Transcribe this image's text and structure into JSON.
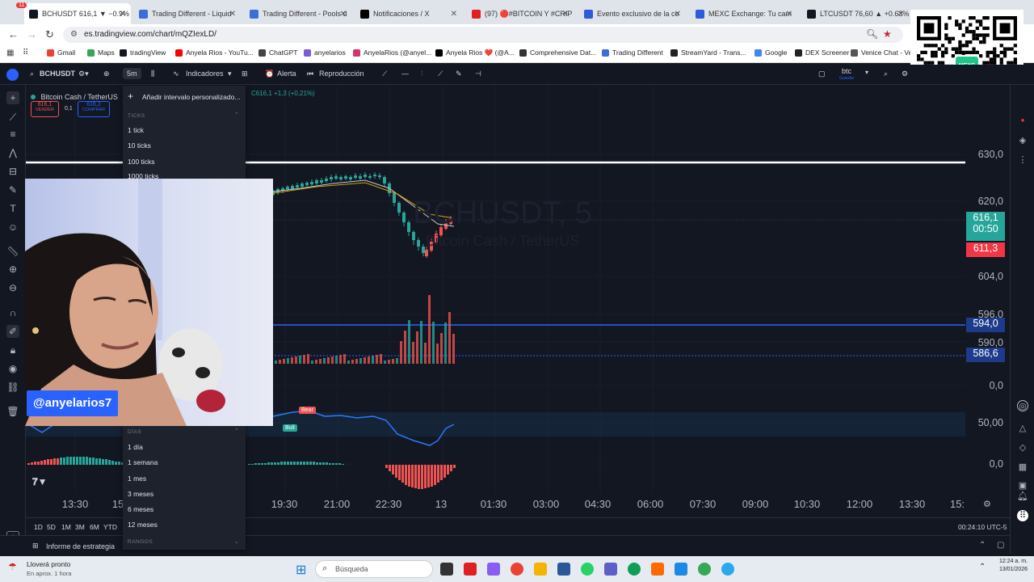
{
  "browser": {
    "tabs": [
      {
        "label": "BCHUSDT 616,1 ▼ −0.9%",
        "color": "#131722",
        "active": true
      },
      {
        "label": "Trading Different - Liquid",
        "color": "#3b6fd6"
      },
      {
        "label": "Trading Different - Pools d",
        "color": "#3b6fd6"
      },
      {
        "label": "Notificaciones / X",
        "color": "#000000"
      },
      {
        "label": "(97) 🔴#BITCOIN Y #CRIP",
        "color": "#e02020"
      },
      {
        "label": "Evento exclusivo de la co",
        "color": "#2e5bd8"
      },
      {
        "label": "MEXC Exchange: Tu cam",
        "color": "#2e5bd8"
      },
      {
        "label": "LTCUSDT 76,60 ▲ +0.63%",
        "color": "#131722"
      }
    ],
    "tab_badge": "11",
    "url": "es.tradingview.com/chart/mQZIexLD/",
    "bookmarks": [
      {
        "label": "Gmail",
        "color": "#ea4335"
      },
      {
        "label": "Maps",
        "color": "#34a853"
      },
      {
        "label": "tradingView",
        "color": "#131722"
      },
      {
        "label": "Anyela Rios - YouTu...",
        "color": "#ff0000"
      },
      {
        "label": "ChatGPT",
        "color": "#444444"
      },
      {
        "label": "anyelarios",
        "color": "#7b5cd6"
      },
      {
        "label": "AnyelaRios (@anyel...",
        "color": "#d6336c"
      },
      {
        "label": "Anyela Rios ❤️ (@A...",
        "color": "#000000"
      },
      {
        "label": "Comprehensive Dat...",
        "color": "#333333"
      },
      {
        "label": "Trading Different",
        "color": "#3b6fd6"
      },
      {
        "label": "StreamYard - Trans...",
        "color": "#222222"
      },
      {
        "label": "Google",
        "color": "#4285f4"
      },
      {
        "label": "DEX Screener",
        "color": "#222222"
      },
      {
        "label": "Venice Chat - Ve",
        "color": "#555555"
      }
    ]
  },
  "toolbar": {
    "symbol": "BCHUSDT",
    "interval": "5m",
    "indicators": "Indicadores",
    "alert": "Alerta",
    "replay": "Reproducción",
    "search_text": "btc",
    "search_sub": "Guardar"
  },
  "legend": {
    "name": "Bitcoin Cash / TetherUS",
    "sell_price": "616,1",
    "sell_label": "VENDER",
    "spread": "0,1",
    "buy_price": "616,2",
    "buy_label": "COMPRAR",
    "change": "C616,1 +1,3 (+0,21%)"
  },
  "watermark": {
    "symbol": "BCHUSDT, 5",
    "name": "Bitcoin Cash / TetherUS"
  },
  "dropdown": {
    "add_custom": "Añadir intervalo personalizado...",
    "ticks_header": "TICKS",
    "ticks": [
      "1 tick",
      "10 ticks",
      "100 ticks",
      "1000 ticks"
    ],
    "days_header": "DÍAS",
    "days": [
      "1 día",
      "1 semana",
      "1 mes",
      "3 meses",
      "6 meses",
      "12 meses"
    ],
    "ranges_header": "RANGOS"
  },
  "price_axis": {
    "labels": [
      "630,0",
      "620,0",
      "604,0",
      "596,0",
      "590,0",
      "0,0",
      "50,00",
      "0,0"
    ],
    "current_price": "616,1",
    "countdown": "00:50",
    "bid_tag": "611,3",
    "level_tag_1": "594,0",
    "level_tag_2": "586,6"
  },
  "indicator_labels": {
    "bear": "Bear",
    "bull": "Bull"
  },
  "time_axis": [
    "13:30",
    "15",
    "19:30",
    "21:00",
    "22:30",
    "13",
    "01:30",
    "03:00",
    "04:30",
    "06:00",
    "07:30",
    "09:00",
    "10:30",
    "12:00",
    "13:30",
    "15:"
  ],
  "range_bar": {
    "buttons": [
      "1D",
      "5D",
      "1M",
      "3M",
      "6M",
      "YTD"
    ],
    "clock": "00:24:10 UTC-5"
  },
  "bottom": {
    "strategy_report": "Informe de estrategia"
  },
  "webcam": {
    "handle": "@anyelarios7"
  },
  "qr": {
    "label": "MEXC"
  },
  "taskbar": {
    "weather_title": "Lloverá pronto",
    "weather_sub": "En aprox. 1 hora",
    "search_placeholder": "Búsqueda",
    "time": "12:24 a. m.",
    "date": "13/01/2026"
  },
  "colors": {
    "up": "#26a69a",
    "down": "#ef5350",
    "level": "#2962ff",
    "accent": "#2962ff"
  }
}
